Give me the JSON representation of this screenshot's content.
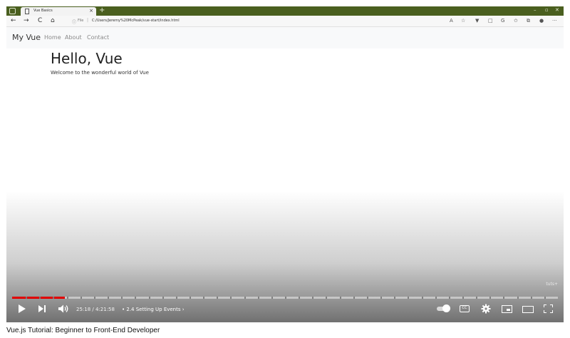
{
  "browser": {
    "tab_title": "Vue Basics",
    "tab_close": "×",
    "new_tab": "+",
    "window_controls": [
      "–",
      "▫",
      "✕"
    ],
    "nav_icons": [
      "←",
      "→",
      "C",
      "⌂"
    ],
    "url_scheme_label": "File",
    "url_info_icon": "ⓘ",
    "url_separator": "|",
    "url": "C:/Users/Jeremy%20McPeak/vue-start/index.html",
    "toolbar_icons": [
      "A",
      "☆",
      "▼",
      "□",
      "G",
      "✩",
      "⧉",
      "●",
      "···"
    ]
  },
  "page": {
    "brand": "My Vue",
    "nav_links": [
      "Home",
      "About",
      "Contact"
    ],
    "heading": "Hello, Vue",
    "subtitle": "Welcome to the wonderful world of Vue"
  },
  "player": {
    "watermark": "tuts+",
    "time": "25:18 / 4:21:58",
    "chapter_prefix": "•",
    "chapter": "2.4 Setting Up Events",
    "chapter_arrow": "›",
    "progress_fraction": 0.097,
    "cc_label": "CC",
    "progress_color": "#e00000"
  },
  "caption": "Vue.js Tutorial: Beginner to Front-End Developer"
}
